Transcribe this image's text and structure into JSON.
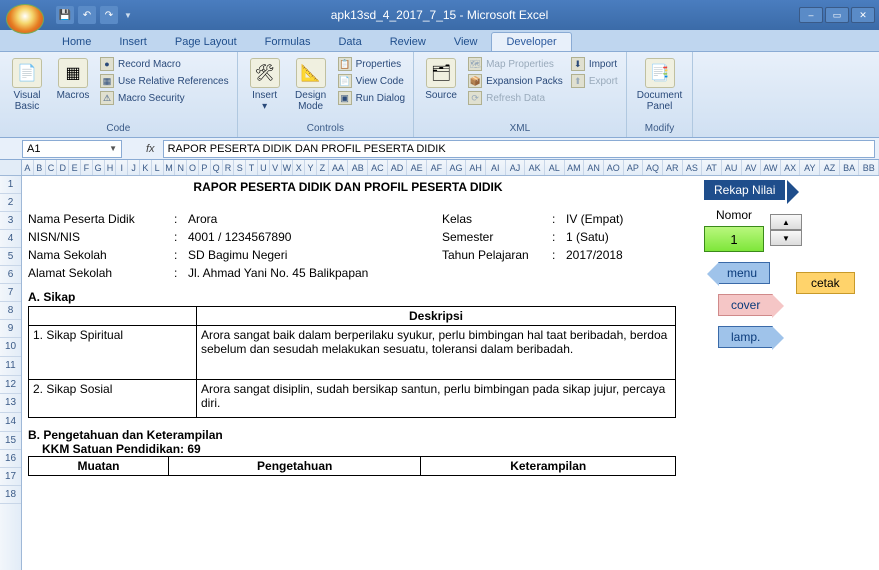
{
  "app": {
    "title": "apk13sd_4_2017_7_15 - Microsoft Excel"
  },
  "tabs": [
    "Home",
    "Insert",
    "Page Layout",
    "Formulas",
    "Data",
    "Review",
    "View",
    "Developer"
  ],
  "active_tab": "Developer",
  "ribbon": {
    "code": {
      "visual_basic": "Visual\nBasic",
      "macros": "Macros",
      "record_macro": "Record Macro",
      "use_relative": "Use Relative References",
      "macro_security": "Macro Security",
      "label": "Code"
    },
    "controls": {
      "insert": "Insert",
      "design_mode": "Design\nMode",
      "properties": "Properties",
      "view_code": "View Code",
      "run_dialog": "Run Dialog",
      "label": "Controls"
    },
    "xml": {
      "source": "Source",
      "map_properties": "Map Properties",
      "expansion_packs": "Expansion Packs",
      "refresh_data": "Refresh Data",
      "import": "Import",
      "export": "Export",
      "label": "XML"
    },
    "modify": {
      "document_panel": "Document\nPanel",
      "label": "Modify"
    }
  },
  "name_box": "A1",
  "formula_bar": "RAPOR PESERTA DIDIK DAN PROFIL PESERTA DIDIK",
  "columns": [
    "A",
    "B",
    "C",
    "D",
    "E",
    "F",
    "G",
    "H",
    "I",
    "J",
    "K",
    "L",
    "M",
    "N",
    "O",
    "P",
    "Q",
    "R",
    "S",
    "T",
    "U",
    "V",
    "W",
    "X",
    "Y",
    "Z",
    "AA",
    "AB",
    "AC",
    "AD",
    "AE",
    "AF",
    "AG",
    "AH",
    "AI",
    "AJ",
    "AK",
    "AL",
    "AM",
    "AN",
    "AO",
    "AP",
    "AQ",
    "AR",
    "AS",
    "AT",
    "AU",
    "AV",
    "AW",
    "AX",
    "AY",
    "AZ",
    "BA",
    "BB"
  ],
  "rows": [
    1,
    2,
    3,
    4,
    5,
    6,
    7,
    8,
    9,
    10,
    11,
    12,
    13,
    14,
    15,
    16,
    17,
    18
  ],
  "report": {
    "title": "RAPOR PESERTA DIDIK DAN PROFIL PESERTA DIDIK",
    "fields": {
      "nama_label": "Nama Peserta Didik",
      "nama_value": "Arora",
      "nisn_label": "NISN/NIS",
      "nisn_value": "4001 / 1234567890",
      "sekolah_label": "Nama Sekolah",
      "sekolah_value": "SD Bagimu Negeri",
      "alamat_label": "Alamat Sekolah",
      "alamat_value": "Jl. Ahmad Yani No. 45 Balikpapan",
      "kelas_label": "Kelas",
      "kelas_value": "IV (Empat)",
      "semester_label": "Semester",
      "semester_value": "1 (Satu)",
      "tahun_label": "Tahun Pelajaran",
      "tahun_value": "2017/2018"
    },
    "sectionA": "A. Sikap",
    "deskripsi_header": "Deskripsi",
    "sikap1_label": "1. Sikap Spiritual",
    "sikap1_text": "Arora sangat baik dalam  berperilaku syukur, perlu bimbingan hal taat beribadah, berdoa sebelum dan sesudah melakukan sesuatu, toleransi dalam beribadah.",
    "sikap2_label": "2. Sikap Sosial",
    "sikap2_text": "Arora sangat disiplin, sudah bersikap santun, perlu bimbingan pada sikap jujur, percaya diri.",
    "sectionB": "B. Pengetahuan dan Keterampilan",
    "kkm": "KKM Satuan Pendidikan: 69",
    "muatan": "Muatan",
    "pengetahuan": "Pengetahuan",
    "keterampilan": "Keterampilan"
  },
  "side": {
    "rekap": "Rekap Nilai",
    "nomor_label": "Nomor",
    "nomor_value": "1",
    "menu": "menu",
    "cetak": "cetak",
    "cover": "cover",
    "lamp": "lamp."
  }
}
